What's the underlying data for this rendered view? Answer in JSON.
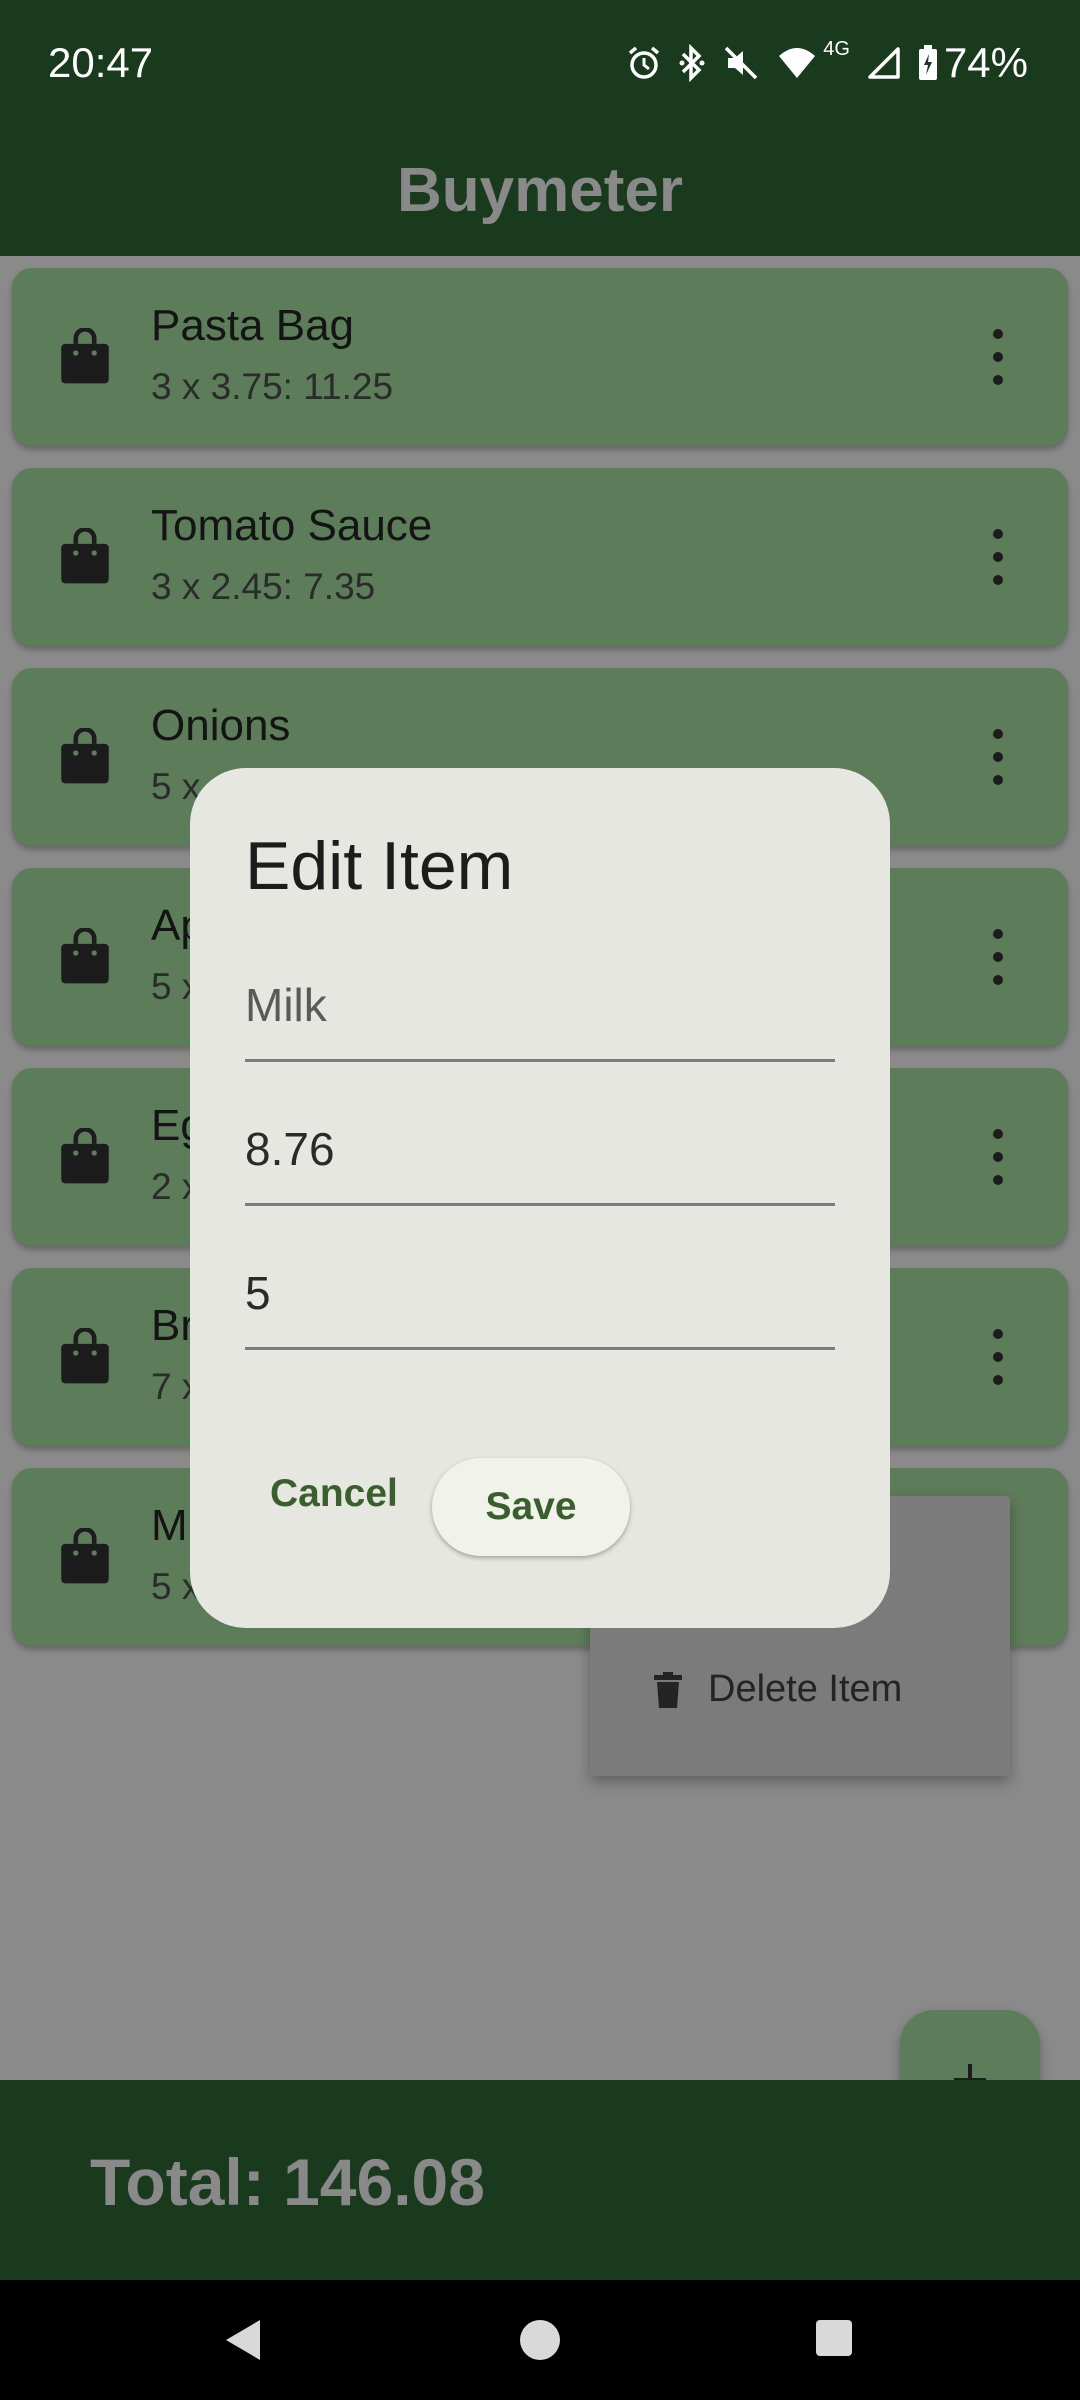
{
  "status_bar": {
    "time": "20:47",
    "network": "4G",
    "battery": "74%",
    "icons": [
      "alarm-icon",
      "bluetooth-icon",
      "mute-icon",
      "wifi-icon",
      "signal-icon",
      "battery-charging-icon"
    ]
  },
  "app": {
    "title": "Buymeter"
  },
  "items": [
    {
      "name": "Pasta Bag",
      "detail": "3 x 3.75: 11.25"
    },
    {
      "name": "Tomato Sauce",
      "detail": "3 x 2.45: 7.35"
    },
    {
      "name": "Onions",
      "detail": "5 x"
    },
    {
      "name": "Ap",
      "detail": "5 x"
    },
    {
      "name": "Eg",
      "detail": "2 x"
    },
    {
      "name": "Br",
      "detail": "7 x"
    },
    {
      "name": "M",
      "detail": "5 x"
    }
  ],
  "item_menu": {
    "delete_label": "Delete Item"
  },
  "dialog": {
    "title": "Edit Item",
    "name_value": "Milk",
    "price_value": "8.76",
    "quantity_value": "5",
    "cancel_label": "Cancel",
    "save_label": "Save"
  },
  "fab": {
    "icon": "plus-icon"
  },
  "footer": {
    "total_text": "Total: 146.08"
  },
  "colors": {
    "bar": "#1a3a1e",
    "card": "#5d7c5a",
    "dialog": "#e6e7e0",
    "accent": "#3b5e2e"
  }
}
